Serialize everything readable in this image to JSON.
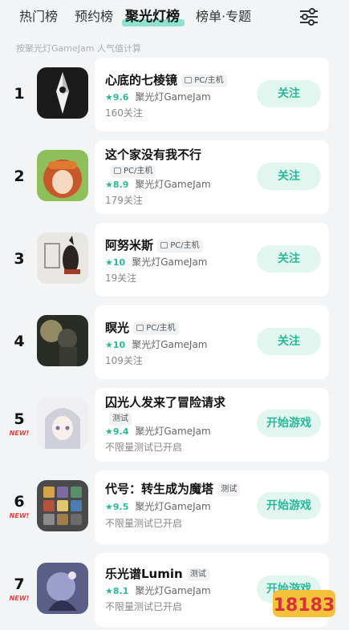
{
  "tabs": [
    {
      "label": "热门榜",
      "active": false
    },
    {
      "label": "预约榜",
      "active": false
    },
    {
      "label": "聚光灯榜",
      "active": true
    },
    {
      "label": "榜单·专题",
      "active": false
    }
  ],
  "subtitle": "按聚光灯GameJam 人气值计算",
  "colors": {
    "accent": "#2bb89a",
    "button_bg": "#e2f6f0",
    "new_badge": "#ee3b3b"
  },
  "items": [
    {
      "rank": "1",
      "new": "",
      "title": "心底的七棱镜",
      "tag": "PC/主机",
      "score": "9.6",
      "source": "聚光灯GameJam",
      "sub": "160关注",
      "button": "关注"
    },
    {
      "rank": "2",
      "new": "",
      "title": "这个家没有我不行",
      "tag": "PC/主机",
      "score": "8.9",
      "source": "聚光灯GameJam",
      "sub": "179关注",
      "button": "关注"
    },
    {
      "rank": "3",
      "new": "",
      "title": "阿努米斯",
      "tag": "PC/主机",
      "score": "10",
      "source": "聚光灯GameJam",
      "sub": "19关注",
      "button": "关注"
    },
    {
      "rank": "4",
      "new": "",
      "title": "瞑光",
      "tag": "PC/主机",
      "score": "10",
      "source": "聚光灯GameJam",
      "sub": "109关注",
      "button": "关注"
    },
    {
      "rank": "5",
      "new": "NEW!",
      "title": "囚光人发来了冒险请求",
      "tag": "测试",
      "score": "9.4",
      "source": "聚光灯GameJam",
      "sub": "不限量测试已开启",
      "button": "开始游戏"
    },
    {
      "rank": "6",
      "new": "NEW!",
      "title": "代号：转生成为魔塔",
      "tag": "测试",
      "score": "9.5",
      "source": "聚光灯GameJam",
      "sub": "不限量测试已开启",
      "button": "开始游戏"
    },
    {
      "rank": "7",
      "new": "NEW!",
      "title": "乐光谱Lumin",
      "tag": "测试",
      "score": "8.1",
      "source": "聚光灯GameJam",
      "sub": "不限量测试已开启",
      "button": "开始游戏"
    }
  ],
  "icons": {
    "filter": "filter-sliders-icon",
    "tag_platform": "monitor-icon"
  },
  "watermark": {
    "text": "18183"
  }
}
